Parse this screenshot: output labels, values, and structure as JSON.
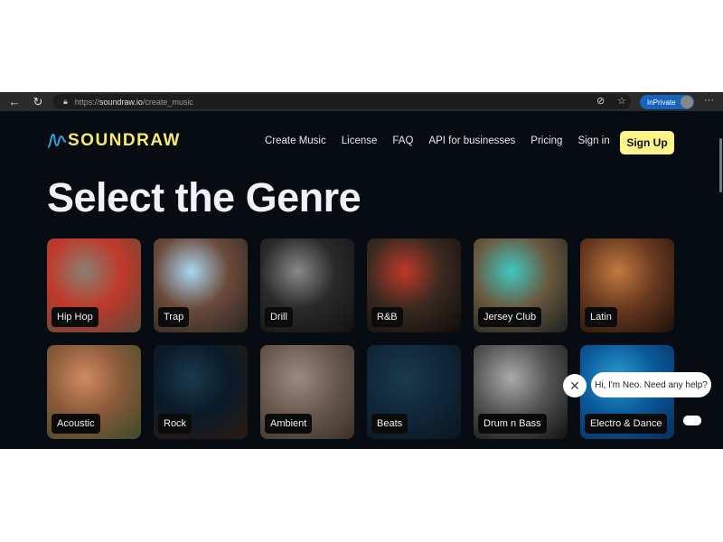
{
  "browser": {
    "url_prefix": "https://",
    "url_domain": "soundraw.io",
    "url_path": "/create_music",
    "inprivate_label": "InPrivate"
  },
  "header": {
    "logo": "SOUNDRAW",
    "menu": [
      "Create Music",
      "License",
      "FAQ",
      "API for businesses",
      "Pricing",
      "Sign in"
    ],
    "signup_label": "Sign Up"
  },
  "main": {
    "title": "Select the Genre",
    "genres": [
      {
        "label": "Hip Hop",
        "colors": [
          "#8a8070",
          "#c0392b",
          "#5a4a3a"
        ]
      },
      {
        "label": "Trap",
        "colors": [
          "#a9d6f0",
          "#6b4a3a",
          "#2a2522"
        ]
      },
      {
        "label": "Drill",
        "colors": [
          "#888888",
          "#2a2a2a",
          "#111111"
        ]
      },
      {
        "label": "R&B",
        "colors": [
          "#c0392b",
          "#3a2a20",
          "#0e0c0b"
        ]
      },
      {
        "label": "Jersey Club",
        "colors": [
          "#3fc7c0",
          "#6a5a40",
          "#1a2020"
        ]
      },
      {
        "label": "Latin",
        "colors": [
          "#c07a40",
          "#6a3a20",
          "#1a100a"
        ]
      },
      {
        "label": "Acoustic",
        "colors": [
          "#d08a60",
          "#8a5a3a",
          "#3a4a2a"
        ]
      },
      {
        "label": "Rock",
        "colors": [
          "#1a3a4a",
          "#0a1a2a",
          "#2a1a10"
        ]
      },
      {
        "label": "Ambient",
        "colors": [
          "#9a8a80",
          "#6a5a50",
          "#3a3028"
        ]
      },
      {
        "label": "Beats",
        "colors": [
          "#1a3a4a",
          "#10283a",
          "#0a1520"
        ]
      },
      {
        "label": "Drum n Bass",
        "colors": [
          "#aaaaaa",
          "#555555",
          "#111111"
        ]
      },
      {
        "label": "Electro & Dance",
        "colors": [
          "#2a9ad0",
          "#0a5a9a",
          "#0a2a5a"
        ]
      }
    ]
  },
  "chat": {
    "message": "Hi, I'm Neo. Need any help?"
  },
  "colors": {
    "page_bg": "#070b12",
    "accent": "#fdf58a",
    "logo": "#f5ea77"
  }
}
